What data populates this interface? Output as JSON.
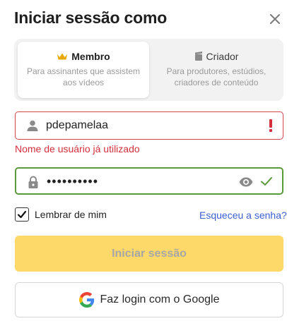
{
  "header": {
    "title": "Iniciar sessão como",
    "close_icon": "close-icon"
  },
  "tabs": [
    {
      "label": "Membro",
      "description": "Para assinantes que assistem aos vídeos",
      "icon": "crown-icon",
      "selected": true
    },
    {
      "label": "Criador",
      "description": "Para produtores, estúdios, criadores de conteúdo",
      "icon": "clapperboard-icon",
      "selected": false
    }
  ],
  "username": {
    "value": "pdepamelaa",
    "error": "Nome de usuário já utilizado",
    "icon": "user-icon",
    "status_icon": "exclamation-icon"
  },
  "password": {
    "value": "••••••••••",
    "icon": "lock-icon",
    "toggle_icon": "eye-icon",
    "status_icon": "check-icon"
  },
  "remember": {
    "label": "Lembrar de mim",
    "checked": true
  },
  "forgot_link": "Esqueceu a senha?",
  "buttons": {
    "login": "Iniciar sessão",
    "google": "Faz login com o Google"
  },
  "colors": {
    "accent_yellow": "#fdd96a",
    "error_red": "#d32f3c",
    "success_green": "#5a9a3a",
    "link_blue": "#3d5fd0",
    "crown_gold": "#e8a800"
  }
}
